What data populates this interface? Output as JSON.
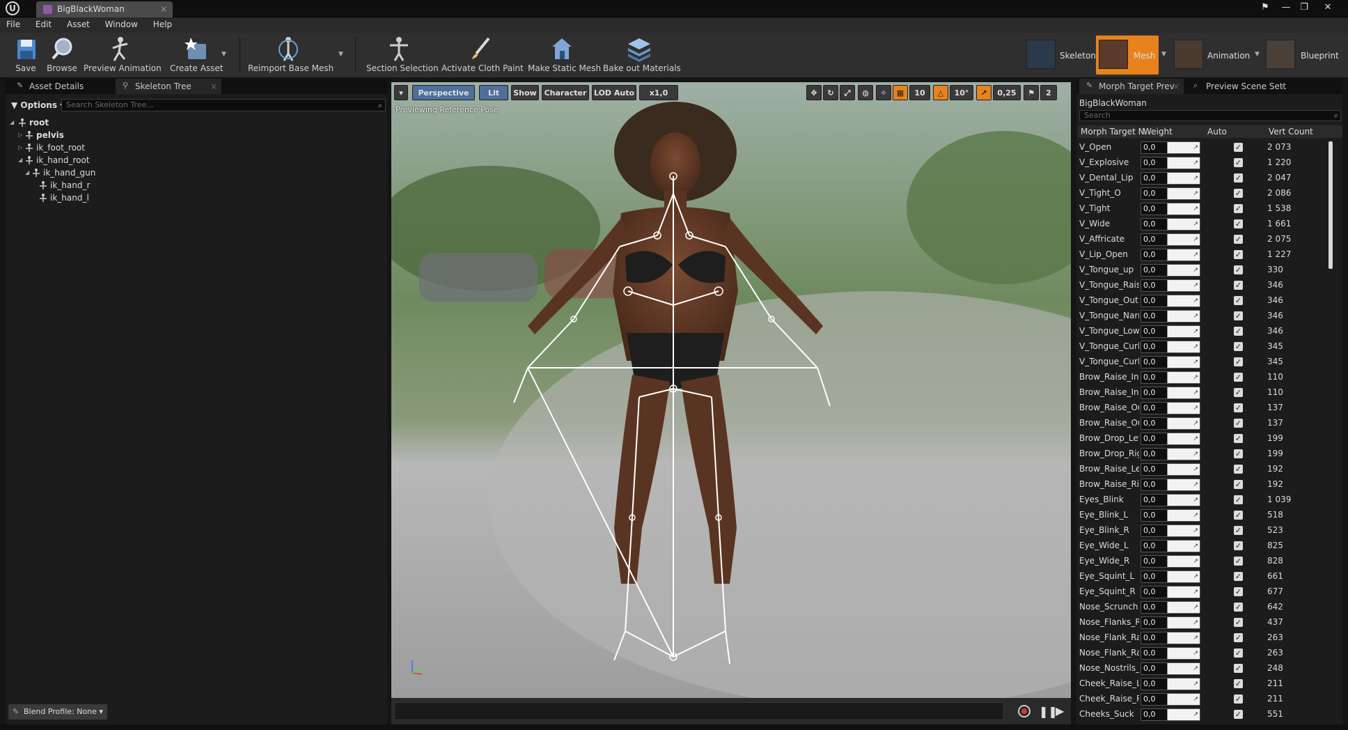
{
  "window": {
    "tab_title": "BigBlackWoman",
    "tab_close": "×",
    "logo": "U",
    "controls": [
      "⚑",
      "—",
      "❐",
      "✕"
    ]
  },
  "menu": [
    "File",
    "Edit",
    "Asset",
    "Window",
    "Help"
  ],
  "toolbar": {
    "buttons": [
      "Save",
      "Browse",
      "Preview Animation",
      "Create Asset",
      "Reimport Base Mesh",
      "Section Selection",
      "Activate Cloth Paint",
      "Make Static Mesh",
      "Bake out Materials"
    ],
    "modes": [
      "Skeleton",
      "Mesh",
      "Animation",
      "Blueprint"
    ]
  },
  "left_panel": {
    "tabs": [
      "Asset Details",
      "Skeleton Tree"
    ],
    "options_label": "▼ Options ▾",
    "search_placeholder": "Search Skeleton Tree...",
    "tree": [
      {
        "label": "root",
        "arrow": "◢",
        "bold": true
      },
      {
        "label": "pelvis",
        "arrow": "▷",
        "bold": true
      },
      {
        "label": "ik_foot_root",
        "arrow": "▷",
        "bold": false
      },
      {
        "label": "ik_hand_root",
        "arrow": "◢",
        "bold": false
      },
      {
        "label": "ik_hand_gun",
        "arrow": "◢",
        "bold": false
      },
      {
        "label": "ik_hand_r",
        "arrow": "",
        "bold": false
      },
      {
        "label": "ik_hand_l",
        "arrow": "",
        "bold": false
      }
    ],
    "blend_profile": "Blend Profile: None ▾"
  },
  "viewport": {
    "buttons": {
      "dropdown": "▾",
      "perspective": "Perspective",
      "lit": "Lit",
      "show": "Show",
      "character": "Character",
      "lod": "LOD Auto",
      "speed": "x1,0",
      "grid_snap": "10",
      "rot_snap": "10°",
      "scale_snap": "0,25",
      "cam_speed": "2"
    },
    "preview_text": "Previewing Reference Pose"
  },
  "right_panel": {
    "tabs": [
      "Morph Target Prev",
      "Preview Scene Sett"
    ],
    "asset_name": "BigBlackWoman",
    "search_placeholder": "Search",
    "headers": [
      "Morph Target N",
      "Weight",
      "Auto",
      "Vert Count"
    ],
    "rows": [
      {
        "name": "V_Open",
        "weight": "0,0",
        "count": "2 073"
      },
      {
        "name": "V_Explosive",
        "weight": "0,0",
        "count": "1 220"
      },
      {
        "name": "V_Dental_Lip",
        "weight": "0,0",
        "count": "2 047"
      },
      {
        "name": "V_Tight_O",
        "weight": "0,0",
        "count": "2 086"
      },
      {
        "name": "V_Tight",
        "weight": "0,0",
        "count": "1 538"
      },
      {
        "name": "V_Wide",
        "weight": "0,0",
        "count": "1 661"
      },
      {
        "name": "V_Affricate",
        "weight": "0,0",
        "count": "2 075"
      },
      {
        "name": "V_Lip_Open",
        "weight": "0,0",
        "count": "1 227"
      },
      {
        "name": "V_Tongue_up",
        "weight": "0,0",
        "count": "330"
      },
      {
        "name": "V_Tongue_Raise",
        "weight": "0,0",
        "count": "346"
      },
      {
        "name": "V_Tongue_Out",
        "weight": "0,0",
        "count": "346"
      },
      {
        "name": "V_Tongue_Narro",
        "weight": "0,0",
        "count": "346"
      },
      {
        "name": "V_Tongue_Lowe",
        "weight": "0,0",
        "count": "346"
      },
      {
        "name": "V_Tongue_Curl_l",
        "weight": "0,0",
        "count": "345"
      },
      {
        "name": "V_Tongue_Curl_l",
        "weight": "0,0",
        "count": "345"
      },
      {
        "name": "Brow_Raise_Inne",
        "weight": "0,0",
        "count": "110"
      },
      {
        "name": "Brow_Raise_Inne",
        "weight": "0,0",
        "count": "110"
      },
      {
        "name": "Brow_Raise_Out",
        "weight": "0,0",
        "count": "137"
      },
      {
        "name": "Brow_Raise_Out",
        "weight": "0,0",
        "count": "137"
      },
      {
        "name": "Brow_Drop_Left",
        "weight": "0,0",
        "count": "199"
      },
      {
        "name": "Brow_Drop_Righ",
        "weight": "0,0",
        "count": "199"
      },
      {
        "name": "Brow_Raise_Left",
        "weight": "0,0",
        "count": "192"
      },
      {
        "name": "Brow_Raise_Rigl",
        "weight": "0,0",
        "count": "192"
      },
      {
        "name": "Eyes_Blink",
        "weight": "0,0",
        "count": "1 039"
      },
      {
        "name": "Eye_Blink_L",
        "weight": "0,0",
        "count": "518"
      },
      {
        "name": "Eye_Blink_R",
        "weight": "0,0",
        "count": "523"
      },
      {
        "name": "Eye_Wide_L",
        "weight": "0,0",
        "count": "825"
      },
      {
        "name": "Eye_Wide_R",
        "weight": "0,0",
        "count": "828"
      },
      {
        "name": "Eye_Squint_L",
        "weight": "0,0",
        "count": "661"
      },
      {
        "name": "Eye_Squint_R",
        "weight": "0,0",
        "count": "677"
      },
      {
        "name": "Nose_Scrunch",
        "weight": "0,0",
        "count": "642"
      },
      {
        "name": "Nose_Flanks_Ra",
        "weight": "0,0",
        "count": "437"
      },
      {
        "name": "Nose_Flank_Rais",
        "weight": "0,0",
        "count": "263"
      },
      {
        "name": "Nose_Flank_Rais",
        "weight": "0,0",
        "count": "263"
      },
      {
        "name": "Nose_Nostrils_Fl",
        "weight": "0,0",
        "count": "248"
      },
      {
        "name": "Cheek_Raise_L",
        "weight": "0,0",
        "count": "211"
      },
      {
        "name": "Cheek_Raise_R",
        "weight": "0,0",
        "count": "211"
      },
      {
        "name": "Cheeks_Suck",
        "weight": "0,0",
        "count": "551"
      }
    ]
  },
  "colors": {
    "accent": "#e8821d",
    "lit_blue": "#4d6f9a",
    "panel": "#1c1c1c"
  }
}
